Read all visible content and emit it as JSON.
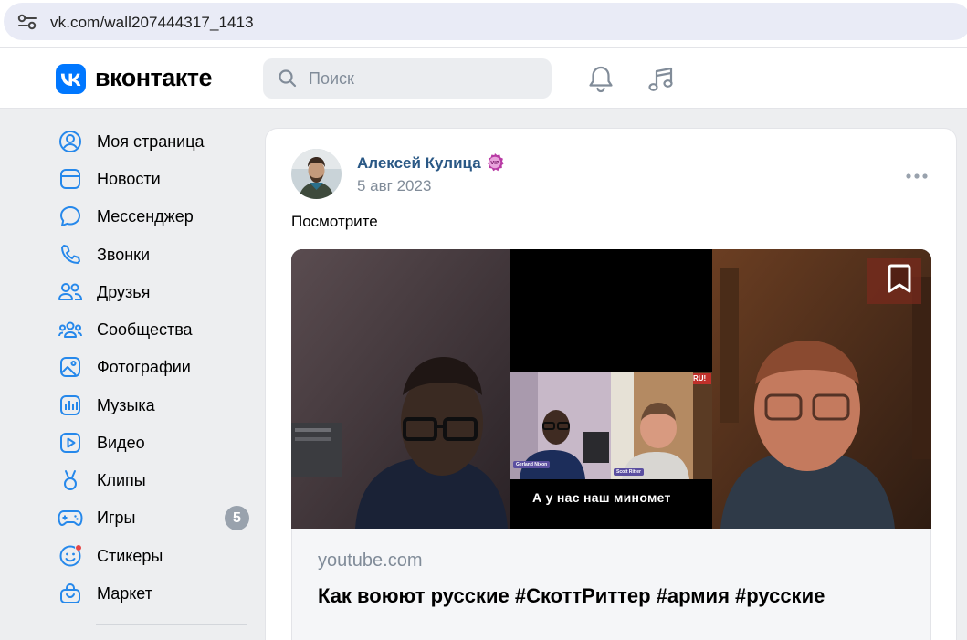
{
  "browser": {
    "url": "vk.com/wall207444317_1413",
    "icons": {
      "site_info": "tune-icon"
    }
  },
  "header": {
    "logo_text": "вконтакте",
    "search_placeholder": "Поиск",
    "icons": {
      "search": "search-icon",
      "notifications": "bell-icon",
      "music": "music-note-icon"
    }
  },
  "sidebar": {
    "items": [
      {
        "label": "Моя страница",
        "icon": "user-circle-icon"
      },
      {
        "label": "Новости",
        "icon": "news-feed-icon"
      },
      {
        "label": "Мессенджер",
        "icon": "message-bubble-icon"
      },
      {
        "label": "Звонки",
        "icon": "phone-icon"
      },
      {
        "label": "Друзья",
        "icon": "friends-icon"
      },
      {
        "label": "Сообщества",
        "icon": "communities-icon"
      },
      {
        "label": "Фотографии",
        "icon": "photo-icon"
      },
      {
        "label": "Музыка",
        "icon": "music-icon"
      },
      {
        "label": "Видео",
        "icon": "video-icon"
      },
      {
        "label": "Клипы",
        "icon": "clips-icon"
      },
      {
        "label": "Игры",
        "icon": "gamepad-icon",
        "badge": "5"
      },
      {
        "label": "Стикеры",
        "icon": "sticker-icon"
      },
      {
        "label": "Маркет",
        "icon": "market-bag-icon"
      }
    ]
  },
  "post": {
    "author": "Алексей Кулица",
    "vip_label": "VIP",
    "date": "5 авг 2023",
    "text": "Посмотрите",
    "video": {
      "caption": "А у нас наш миномет",
      "left_tag": "Gerland Nixon",
      "right_tag": "Scott Ritter",
      "corner_mark": "RU!"
    },
    "link": {
      "domain": "youtube.com",
      "title": "Как воюют русские #СкоттРиттер #армия #русские"
    },
    "icons": {
      "more": "more-dots-icon",
      "bookmark": "bookmark-icon",
      "vip": "vip-badge-icon"
    }
  },
  "colors": {
    "brand": "#0077ff",
    "author_link": "#2a5885",
    "muted_text": "#818c99",
    "page_bg": "#edeef0",
    "icon_blue": "#2688eb"
  }
}
